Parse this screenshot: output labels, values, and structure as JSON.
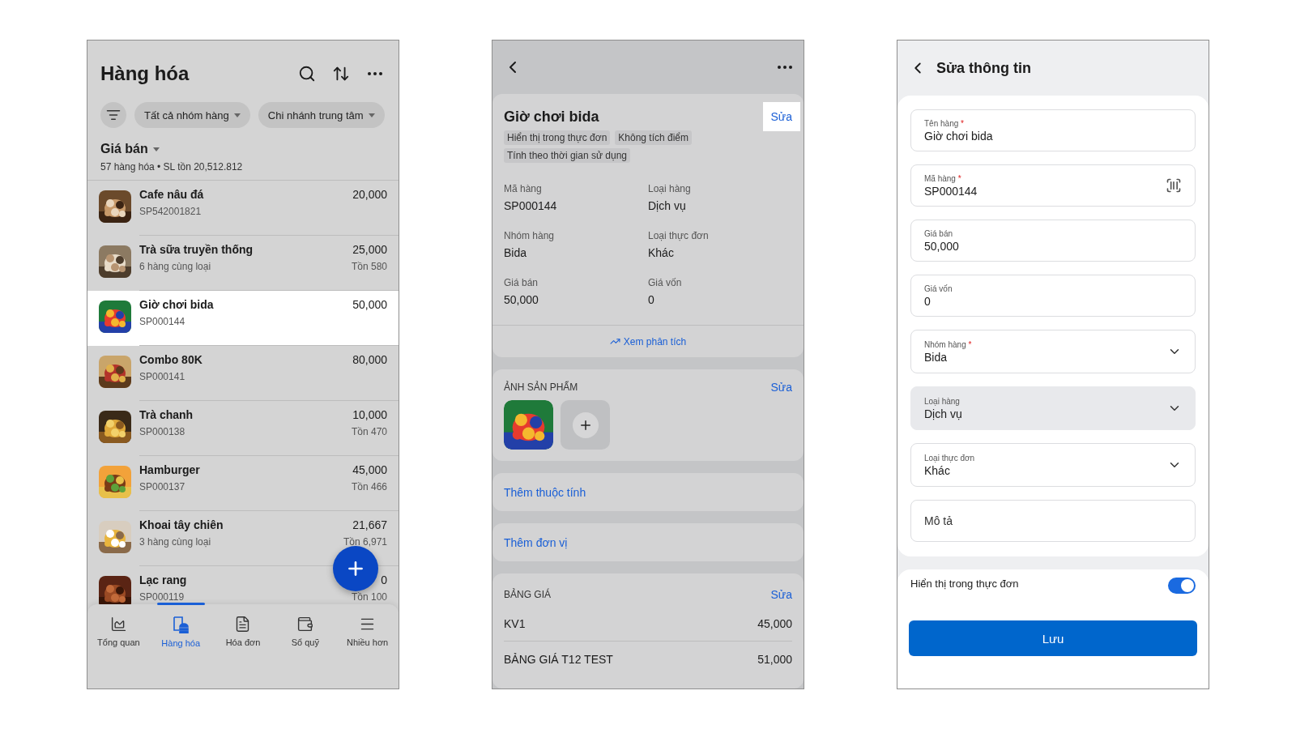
{
  "goods_screen": {
    "title": "Hàng hóa",
    "filters": [
      {
        "label": "Tất cả nhóm hàng"
      },
      {
        "label": "Chi nhánh trung tâm"
      }
    ],
    "sort_label": "Giá bán",
    "summary": "57 hàng hóa • SL tồn 20,512.812",
    "items": [
      {
        "name": "Cafe nâu đá",
        "sub": "SP542001821",
        "price": "20,000",
        "selected": false
      },
      {
        "name": "Trà sữa truyền thống",
        "sub": "6 hàng cùng loại",
        "price": "25,000",
        "stock": "Tồn 580",
        "selected": false
      },
      {
        "name": "Giờ chơi bida",
        "sub": "SP000144",
        "price": "50,000",
        "selected": true
      },
      {
        "name": "Combo 80K",
        "sub": "SP000141",
        "price": "80,000",
        "selected": false
      },
      {
        "name": "Trà chanh",
        "sub": "SP000138",
        "price": "10,000",
        "stock": "Tồn 470",
        "selected": false
      },
      {
        "name": "Hamburger",
        "sub": "SP000137",
        "price": "45,000",
        "stock": "Tồn 466",
        "selected": false
      },
      {
        "name": "Khoai tây chiên",
        "sub": "3 hàng cùng loại",
        "price": "21,667",
        "stock": "Tồn 6,971",
        "selected": false
      },
      {
        "name": "Lạc rang",
        "sub": "SP000119",
        "price": "0",
        "stock": "Tồn 100",
        "selected": false
      }
    ],
    "bottom_nav": [
      {
        "label": "Tổng quan",
        "selected": false
      },
      {
        "label": "Hàng hóa",
        "selected": true
      },
      {
        "label": "Hóa đơn",
        "selected": false
      },
      {
        "label": "Sổ quỹ",
        "selected": false
      },
      {
        "label": "Nhiều hơn",
        "selected": false
      }
    ]
  },
  "detail_screen": {
    "title": "Giờ chơi bida",
    "edit": {
      "label": "Sửa",
      "highlighted": true
    },
    "tags": [
      "Hiển thị trong thực đơn",
      "Không tích điểm",
      "Tính theo thời gian sử dụng"
    ],
    "fields": [
      {
        "label": "Mã hàng",
        "value": "SP000144"
      },
      {
        "label": "Loại hàng",
        "value": "Dịch vụ"
      },
      {
        "label": "Nhóm hàng",
        "value": "Bida"
      },
      {
        "label": "Loại thực đơn",
        "value": "Khác"
      },
      {
        "label": "Giá bán",
        "value": "50,000"
      },
      {
        "label": "Giá vốn",
        "value": "0"
      }
    ],
    "analytics_link": "Xem phân tích",
    "photos_section": {
      "title": "ẢNH SẢN PHẨM",
      "edit": "Sửa"
    },
    "actions": [
      "Thêm thuộc tính",
      "Thêm đơn vị"
    ],
    "price_book": {
      "title": "BẢNG GIÁ",
      "edit": "Sửa",
      "rows": [
        {
          "name": "KV1",
          "price": "45,000"
        },
        {
          "name": "BẢNG GIÁ T12 TEST",
          "price": "51,000"
        }
      ]
    }
  },
  "edit_screen": {
    "title": "Sửa thông tin",
    "fields": [
      {
        "kind": "text",
        "label": "Tên hàng",
        "required_mark": "*",
        "value": "Giờ chơi bida"
      },
      {
        "kind": "barcode",
        "label": "Mã hàng",
        "required_mark": "*",
        "value": "SP000144"
      },
      {
        "kind": "text",
        "label": "Giá bán",
        "value": "50,000"
      },
      {
        "kind": "text",
        "label": "Giá vốn",
        "value": "0"
      },
      {
        "kind": "select",
        "label": "Nhóm hàng",
        "required_mark": "*",
        "value": "Bida",
        "disabled": false
      },
      {
        "kind": "select",
        "label": "Loại hàng",
        "value": "Dịch vụ",
        "disabled": true
      },
      {
        "kind": "select",
        "label": "Loại thực đơn",
        "value": "Khác",
        "disabled": false
      },
      {
        "kind": "text",
        "placeholder": "Mô tả"
      }
    ],
    "toggle": {
      "label": "Hiển thị trong thực đơn",
      "on": true
    },
    "save_button": "Lưu"
  }
}
